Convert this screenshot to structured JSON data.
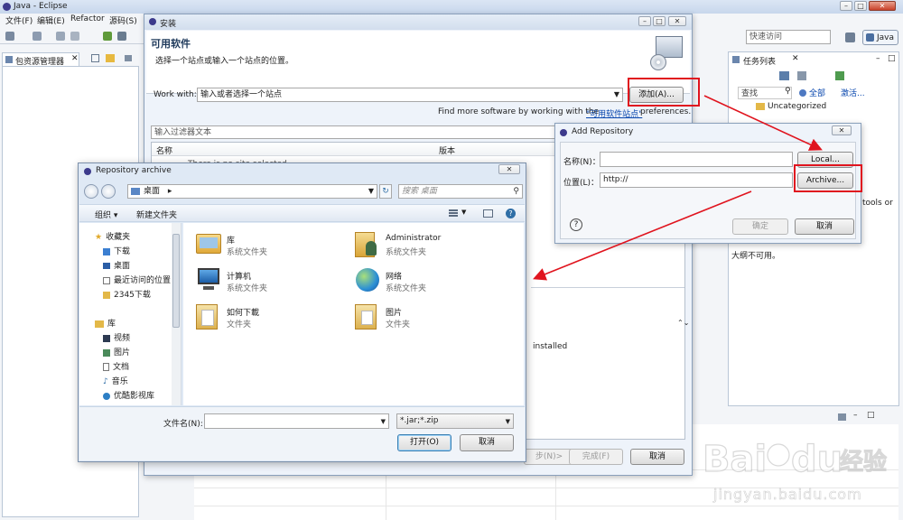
{
  "eclipse": {
    "title": "Java - Eclipse",
    "menu": [
      "文件(F)",
      "编辑(E)",
      "Refactor",
      "源码(S)"
    ],
    "quick_access": "快速访问",
    "perspective": "Java",
    "package_explorer": "包资源管理器",
    "task_list": {
      "title": "任务列表",
      "search": "查找",
      "all": "全部",
      "activate": "激活...",
      "category": "Uncategorized",
      "tools_or": "tools or",
      "unavailable": "大纲不可用。"
    }
  },
  "install": {
    "title": "安装",
    "heading": "可用软件",
    "subtitle": "选择一个站点或输入一个站点的位置。",
    "work_with_label": "Work with:",
    "work_with_value": "输入或者选择一个站点",
    "add_button": "添加(A)...",
    "find_more_prefix": "Find more software by working with the",
    "find_more_link": "\"可用软件站点\"",
    "find_more_suffix": "preferences.",
    "filter_placeholder": "输入过滤器文本",
    "col_name": "名称",
    "col_version": "版本",
    "first_row": "There is no site selected.",
    "installed_text": "installed",
    "next_button": "步(N)>",
    "finish_button": "完成(F)",
    "cancel_button": "取消"
  },
  "add_repo": {
    "title": "Add Repository",
    "name_label": "名称(N)：",
    "location_label": "位置(L)：",
    "location_value": "http://",
    "local_button": "Local...",
    "archive_button": "Archive...",
    "ok_button": "确定",
    "cancel_button": "取消"
  },
  "repo_archive": {
    "title": "Repository archive",
    "address": "桌面",
    "search_placeholder": "搜索 桌面",
    "organize": "组织",
    "new_folder": "新建文件夹",
    "sidebar": {
      "favorites_label": "收藏夹",
      "favorites": [
        "下载",
        "桌面",
        "最近访问的位置",
        "2345下载"
      ],
      "library_label": "库",
      "library": [
        "视频",
        "图片",
        "文档",
        "音乐",
        "优酷影视库"
      ]
    },
    "items": [
      {
        "name": "库",
        "type": "系统文件夹",
        "icon": "library-icon"
      },
      {
        "name": "Administrator",
        "type": "系统文件夹",
        "icon": "user-folder-icon"
      },
      {
        "name": "计算机",
        "type": "系统文件夹",
        "icon": "computer-icon"
      },
      {
        "name": "网络",
        "type": "系统文件夹",
        "icon": "network-icon"
      },
      {
        "name": "如何下載",
        "type": "文件夹",
        "icon": "folder-icon"
      },
      {
        "name": "图片",
        "type": "文件夹",
        "icon": "folder-icon"
      }
    ],
    "filename_label": "文件名(N):",
    "filename_value": "",
    "filter_value": "*.jar;*.zip",
    "open_button": "打开(O)",
    "cancel_button": "取消"
  },
  "watermark": {
    "url": "jingyan.baidu.com"
  },
  "colors": {
    "annotation_red": "#e0141e",
    "link_blue": "#0645ad",
    "heading_blue": "#1e395b"
  }
}
